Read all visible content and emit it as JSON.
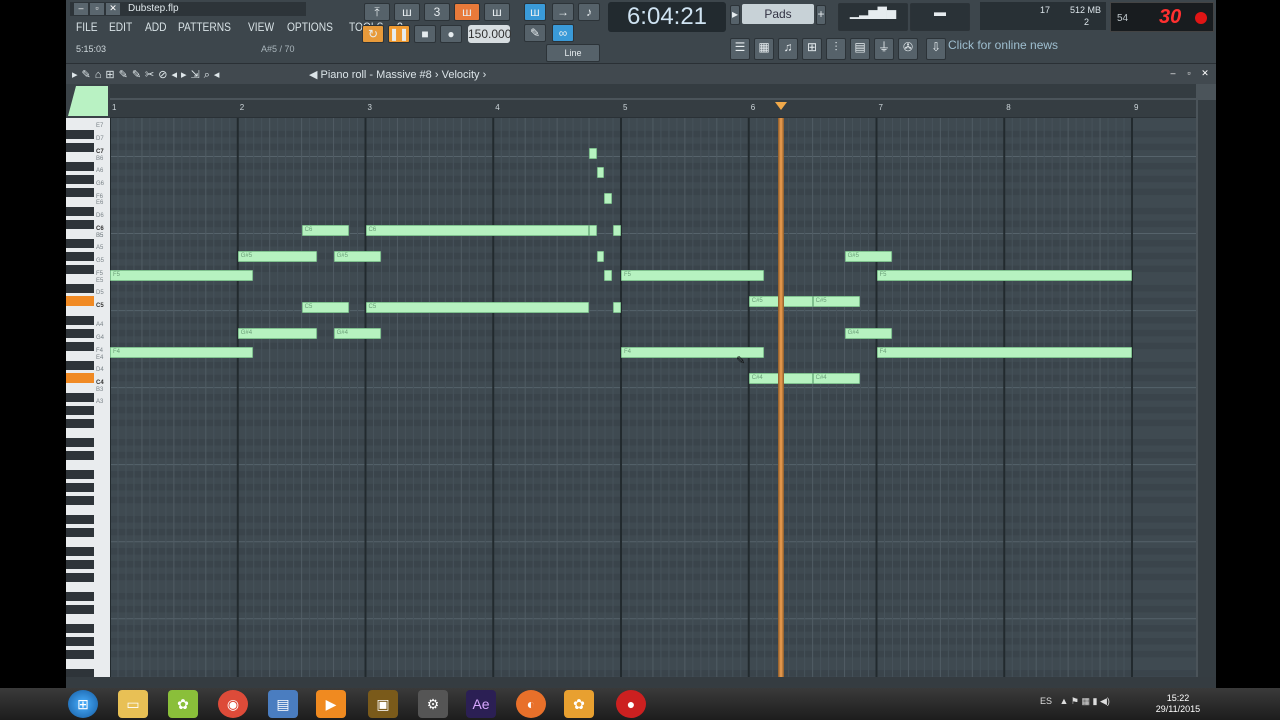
{
  "app": {
    "file_name": "Dubstep.flp",
    "menu": [
      "FILE",
      "EDIT",
      "ADD",
      "PATTERNS",
      "VIEW",
      "OPTIONS",
      "TOOLS",
      "?"
    ],
    "hint_time": "5:15:03",
    "hint_note": "A#5 / 70",
    "song_time": "6:04:21",
    "tempo": "150.000",
    "pattern_mode": "Pads",
    "snap": "Line",
    "news": "Click for online news",
    "cpu_label": "17",
    "mem_label": "512 MB",
    "voices": "2",
    "rec_small": "54",
    "rec_big": "30"
  },
  "piano_roll": {
    "title": "Piano roll - Massive #8",
    "target": "Velocity",
    "bars": [
      "1",
      "2",
      "3",
      "4",
      "5",
      "6",
      "7",
      "8",
      "9"
    ],
    "playhead_bar": 6.25,
    "key_labels": [
      "E7",
      "D7",
      "C7",
      "B6",
      "A6",
      "G6",
      "F6",
      "E6",
      "D6",
      "C6",
      "B5",
      "A5",
      "G5",
      "F5",
      "E5",
      "D5",
      "C5",
      "B5",
      "A4",
      "G4",
      "F4",
      "E4",
      "D4",
      "C4",
      "B3",
      "A3"
    ],
    "notes": [
      {
        "label": "F5",
        "start": 1.0,
        "len": 1.12,
        "pitch": "F5"
      },
      {
        "label": "G#5",
        "start": 2.0,
        "len": 0.62,
        "pitch": "G#5"
      },
      {
        "label": "G#5",
        "start": 2.75,
        "len": 0.37,
        "pitch": "G#5"
      },
      {
        "label": "C6",
        "start": 2.5,
        "len": 0.37,
        "pitch": "C6"
      },
      {
        "label": "C6",
        "start": 3.0,
        "len": 1.75,
        "pitch": "C6"
      },
      {
        "label": "",
        "start": 4.75,
        "len": 0.06,
        "pitch": "C6"
      },
      {
        "label": "",
        "start": 4.94,
        "len": 0.06,
        "pitch": "C6"
      },
      {
        "label": "",
        "start": 4.75,
        "len": 0.06,
        "pitch": "C7"
      },
      {
        "label": "",
        "start": 4.81,
        "len": 0.06,
        "pitch": "A6"
      },
      {
        "label": "",
        "start": 4.87,
        "len": 0.06,
        "pitch": "F6"
      },
      {
        "label": "",
        "start": 4.81,
        "len": 0.06,
        "pitch": "G#5"
      },
      {
        "label": "",
        "start": 4.87,
        "len": 0.06,
        "pitch": "F5"
      },
      {
        "label": "F5",
        "start": 5.0,
        "len": 1.12,
        "pitch": "F5"
      },
      {
        "label": "C#5",
        "start": 6.0,
        "len": 0.5,
        "pitch": "C#5"
      },
      {
        "label": "C#5",
        "start": 6.5,
        "len": 0.37,
        "pitch": "C#5"
      },
      {
        "label": "G#5",
        "start": 6.75,
        "len": 0.37,
        "pitch": "G#5"
      },
      {
        "label": "F5",
        "start": 7.0,
        "len": 2.0,
        "pitch": "F5"
      },
      {
        "label": "C5",
        "start": 2.5,
        "len": 0.37,
        "pitch": "C5"
      },
      {
        "label": "C5",
        "start": 3.0,
        "len": 1.75,
        "pitch": "C5"
      },
      {
        "label": "",
        "start": 4.94,
        "len": 0.06,
        "pitch": "C5"
      },
      {
        "label": "G#4",
        "start": 2.0,
        "len": 0.62,
        "pitch": "G#4"
      },
      {
        "label": "G#4",
        "start": 2.75,
        "len": 0.37,
        "pitch": "G#4"
      },
      {
        "label": "F4",
        "start": 1.0,
        "len": 1.12,
        "pitch": "F4"
      },
      {
        "label": "F4",
        "start": 5.0,
        "len": 1.12,
        "pitch": "F4"
      },
      {
        "label": "G#4",
        "start": 6.75,
        "len": 0.37,
        "pitch": "G#4"
      },
      {
        "label": "F4",
        "start": 7.0,
        "len": 2.0,
        "pitch": "F4"
      },
      {
        "label": "C#4",
        "start": 6.0,
        "len": 0.5,
        "pitch": "C#4"
      },
      {
        "label": "C#4",
        "start": 6.5,
        "len": 0.37,
        "pitch": "C#4"
      }
    ]
  },
  "taskbar": {
    "lang": "ES",
    "time": "15:22",
    "date": "29/11/2015"
  }
}
